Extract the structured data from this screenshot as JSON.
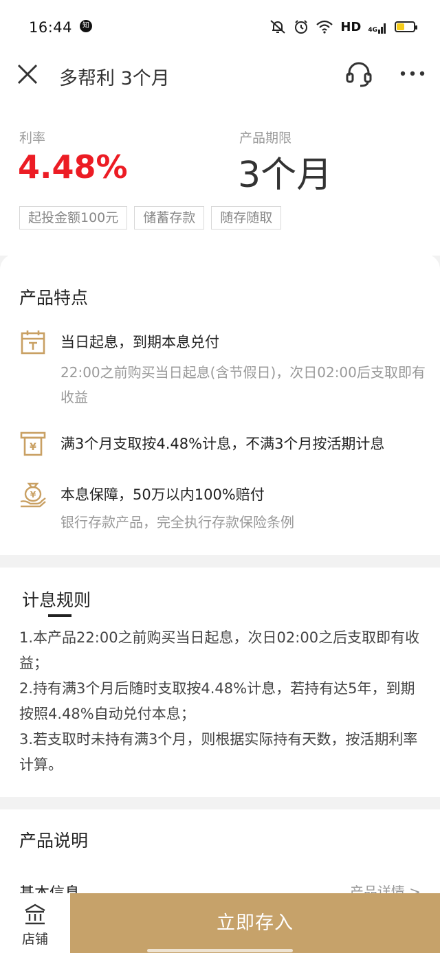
{
  "status_bar": {
    "time": "16:44",
    "zhihu_badge": "知",
    "hd": "HD",
    "network": "4G"
  },
  "header": {
    "title": "多帮利 3个月"
  },
  "product": {
    "rate_label": "利率",
    "rate_value": "4.48%",
    "term_label": "产品期限",
    "term_value": "3个月",
    "tags": [
      "起投金额100元",
      "储蓄存款",
      "随存随取"
    ]
  },
  "features": {
    "title": "产品特点",
    "items": [
      {
        "icon": "calendar-icon",
        "title": "当日起息，到期本息兑付",
        "desc": "22:00之前购买当日起息(含节假日)，次日02:00后支取即有收益"
      },
      {
        "icon": "cash-withdraw-icon",
        "title": "满3个月支取按4.48%计息，不满3个月按活期计息",
        "desc": ""
      },
      {
        "icon": "money-bag-hand-icon",
        "title": "本息保障，50万以内100%赔付",
        "desc": "银行存款产品，完全执行存款保险条例"
      }
    ]
  },
  "rules": {
    "title": "计息规则",
    "items": [
      "1.本产品22:00之前购买当日起息，次日02:00之后支取即有收益；",
      "2.持有满3个月后随时支取按4.48%计息，若持有达5年，到期按照4.48%自动兑付本息；",
      "3.若支取时未持有满3个月，则根据实际持有天数，按活期利率计算。"
    ]
  },
  "description": {
    "title": "产品说明",
    "basic_info": "基本信息",
    "detail_link": "产品详情 >"
  },
  "bottom": {
    "store_label": "店铺",
    "deposit_button": "立即存入"
  },
  "colors": {
    "accent_gold": "#c6a26a",
    "rate_red": "#ec1c24",
    "icon_gold": "#c9a063"
  }
}
